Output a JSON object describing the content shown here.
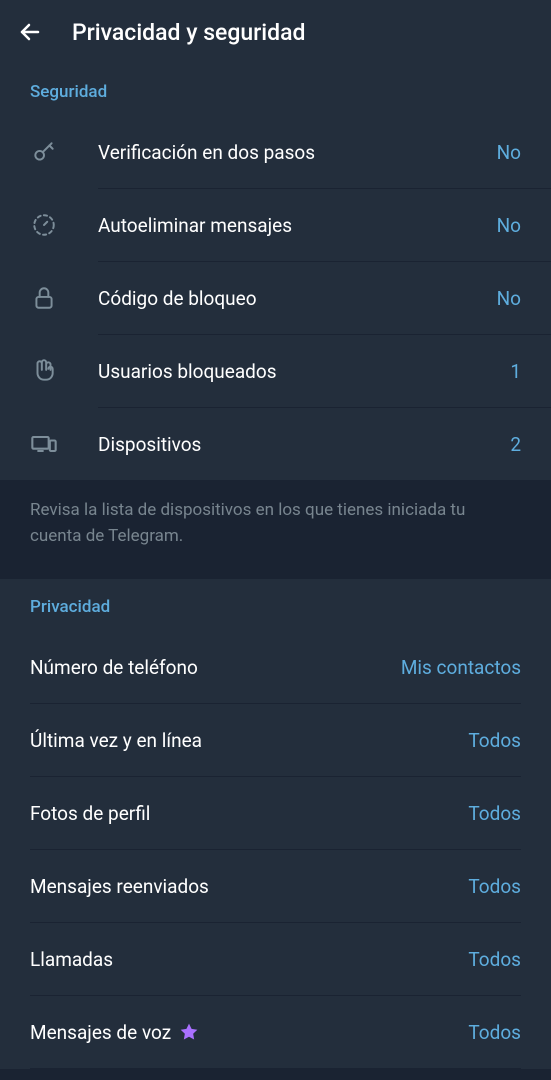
{
  "header": {
    "title": "Privacidad y seguridad"
  },
  "security": {
    "header": "Seguridad",
    "items": [
      {
        "label": "Verificación en dos pasos",
        "value": "No",
        "icon": "key"
      },
      {
        "label": "Autoeliminar mensajes",
        "value": "No",
        "icon": "timer"
      },
      {
        "label": "Código de bloqueo",
        "value": "No",
        "icon": "lock"
      },
      {
        "label": "Usuarios bloqueados",
        "value": "1",
        "icon": "hand"
      },
      {
        "label": "Dispositivos",
        "value": "2",
        "icon": "devices"
      }
    ],
    "hint": "Revisa la lista de dispositivos en los que tienes iniciada tu cuenta de Telegram."
  },
  "privacy": {
    "header": "Privacidad",
    "items": [
      {
        "label": "Número de teléfono",
        "value": "Mis contactos",
        "star": false
      },
      {
        "label": "Última vez y en línea",
        "value": "Todos",
        "star": false
      },
      {
        "label": "Fotos de perfil",
        "value": "Todos",
        "star": false
      },
      {
        "label": "Mensajes reenviados",
        "value": "Todos",
        "star": false
      },
      {
        "label": "Llamadas",
        "value": "Todos",
        "star": false
      },
      {
        "label": "Mensajes de voz",
        "value": "Todos",
        "star": true
      }
    ]
  }
}
